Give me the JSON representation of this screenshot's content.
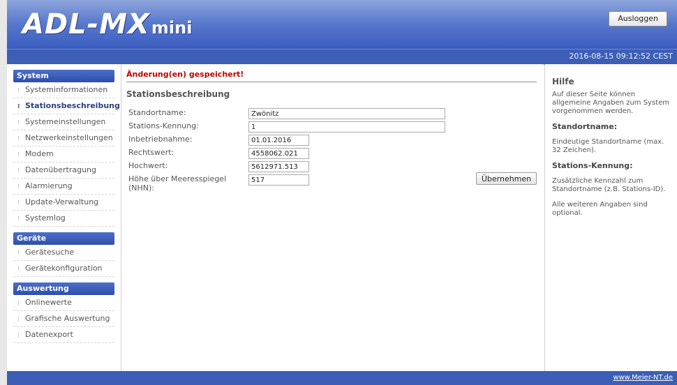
{
  "header": {
    "logo_main": "ADL-MX",
    "logo_mini": "mini",
    "logout_label": "Ausloggen"
  },
  "timestamp": "2016-08-15 09:12:52 CEST",
  "sidebar": {
    "system": {
      "title": "System",
      "items": [
        "Systeminformationen",
        "Stationsbeschreibung",
        "Systemeinstellungen",
        "Netzwerkeinstellungen",
        "Modem",
        "Datenübertragung",
        "Alarmierung",
        "Update-Verwaltung",
        "Systemlog"
      ]
    },
    "geraete": {
      "title": "Geräte",
      "items": [
        "Gerätesuche",
        "Gerätekonfiguration"
      ]
    },
    "auswertung": {
      "title": "Auswertung",
      "items": [
        "Onlinewerte",
        "Grafische Auswertung",
        "Datenexport"
      ]
    }
  },
  "main": {
    "saved_message": "Änderung(en) gespeichert!",
    "title": "Stationsbeschreibung",
    "fields": [
      {
        "label": "Standortname:",
        "value": "Zwönitz"
      },
      {
        "label": "Stations-Kennung:",
        "value": "1"
      },
      {
        "label": "Inbetriebnahme:",
        "value": "01.01.2016"
      },
      {
        "label": "Rechtswert:",
        "value": "4558062.021"
      },
      {
        "label": "Hochwert:",
        "value": "5612971.513"
      },
      {
        "label": "Höhe über Meeresspiegel (NHN):",
        "value": "517"
      }
    ],
    "apply_label": "Übernehmen"
  },
  "help": {
    "title": "Hilfe",
    "intro": "Auf dieser Seite können allgemeine Angaben zum System vorgenommen werden.",
    "h1": "Standortname:",
    "t1": "Eindeutige Standortname (max. 32 Zeichen).",
    "h2": "Stations-Kennung:",
    "t2": "Zusätzliche Kennzahl zum Standortname (z.B. Stations-ID).",
    "t3": "Alle weiteren Angaben sind optional."
  },
  "footer": {
    "link": "www.Meier-NT.de"
  },
  "colors": {
    "accent": "#3c5fb5",
    "error": "#c00000"
  }
}
